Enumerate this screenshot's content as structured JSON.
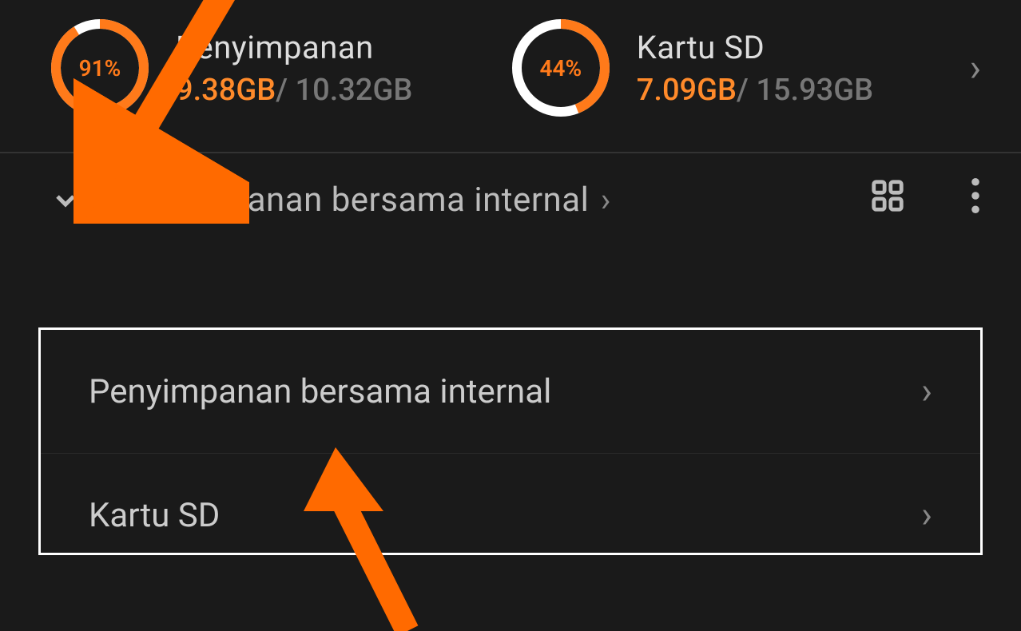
{
  "colors": {
    "accent": "#ff7a1a",
    "ring_track": "#ffffff"
  },
  "storage": {
    "internal": {
      "title": "Penyimpanan",
      "percent_label": "91%",
      "percent": 91,
      "used": "9.38GB",
      "sep": "/",
      "total": "10.32GB"
    },
    "sd": {
      "title": "Kartu SD",
      "percent_label": "44%",
      "percent": 44,
      "used": "7.09GB",
      "sep": "/",
      "total": "15.93GB"
    }
  },
  "location": {
    "breadcrumb": "Penyimpanan bersama internal",
    "crumb_chevron": "›"
  },
  "dropdown": {
    "items": [
      {
        "label": "Penyimpanan bersama internal"
      },
      {
        "label": "Kartu SD"
      }
    ]
  },
  "glyphs": {
    "chevron_right": "›"
  }
}
